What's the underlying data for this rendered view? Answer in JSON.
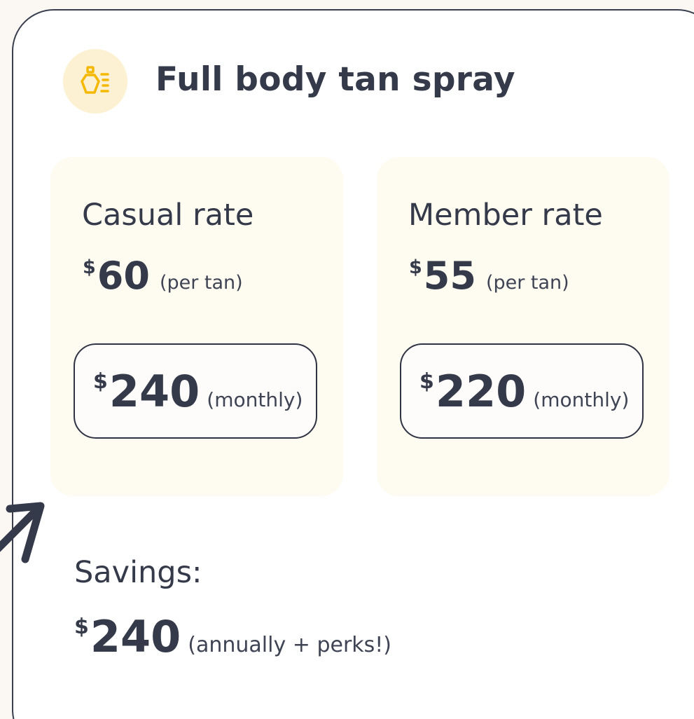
{
  "service": {
    "title": "Full body tan spray",
    "icon": "spray-bottle-icon",
    "accent_color": "#f5b800",
    "icon_bg_color": "#fdf1d3"
  },
  "rates": [
    {
      "name": "Casual rate",
      "currency": "$",
      "price": "60",
      "price_unit": "(per tan)",
      "monthly_currency": "$",
      "monthly_price": "240",
      "monthly_unit": "(monthly)"
    },
    {
      "name": "Member rate",
      "currency": "$",
      "price": "55",
      "price_unit": "(per tan)",
      "monthly_currency": "$",
      "monthly_price": "220",
      "monthly_unit": "(monthly)"
    }
  ],
  "savings": {
    "label": "Savings:",
    "currency": "$",
    "amount": "240",
    "unit": "(annually + perks!)"
  },
  "decor": {
    "arrow_icon": "hand-drawn-arrow-icon"
  }
}
